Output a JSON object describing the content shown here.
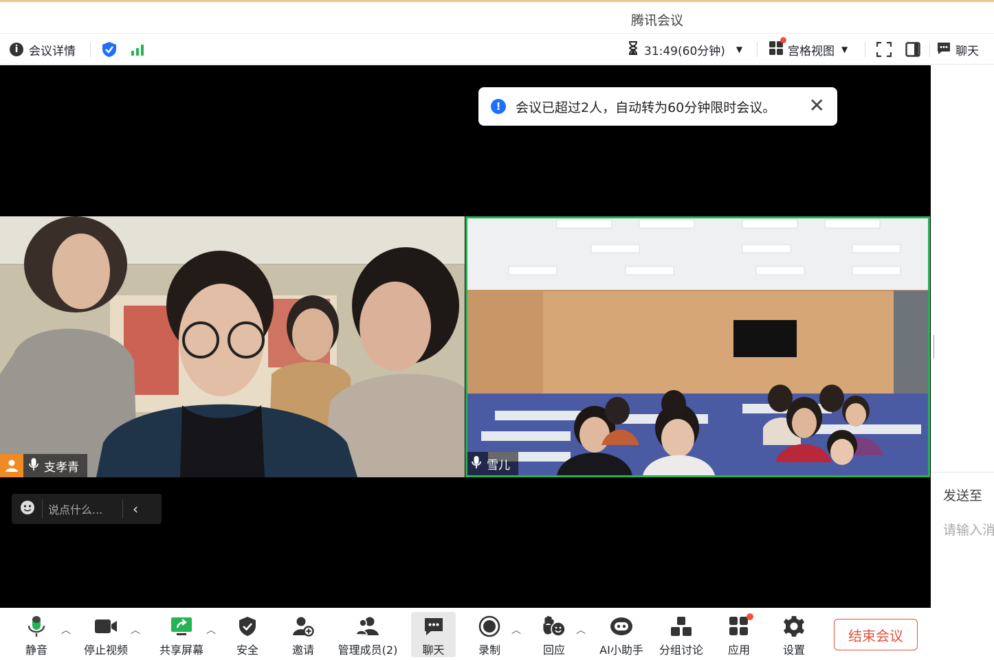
{
  "window": {
    "title": "腾讯会议"
  },
  "topbar": {
    "meeting_details": "会议详情",
    "timer": "31:49(60分钟)",
    "view_mode": "宫格视图",
    "chat": "聊天"
  },
  "toast": {
    "message": "会议已超过2人，自动转为60分钟限时会议。"
  },
  "tiles": [
    {
      "name": "支孝青"
    },
    {
      "name": "雪儿"
    }
  ],
  "chat_input": {
    "placeholder": "说点什么..."
  },
  "side_panel": {
    "send_to": "发送至",
    "input_placeholder": "请输入消"
  },
  "toolbar": {
    "mute": "静音",
    "stop_video": "停止视频",
    "share_screen": "共享屏幕",
    "security": "安全",
    "invite": "邀请",
    "manage_members": "管理成员(2)",
    "chat": "聊天",
    "record": "录制",
    "react": "回应",
    "ai_assistant": "AI小助手",
    "breakout": "分组讨论",
    "apps": "应用",
    "settings": "设置",
    "end_meeting": "结束会议"
  },
  "colors": {
    "accent_green": "#22b455",
    "primary_blue": "#1f6fff",
    "end_red": "#e0533b",
    "badge_red": "#f0503b"
  }
}
